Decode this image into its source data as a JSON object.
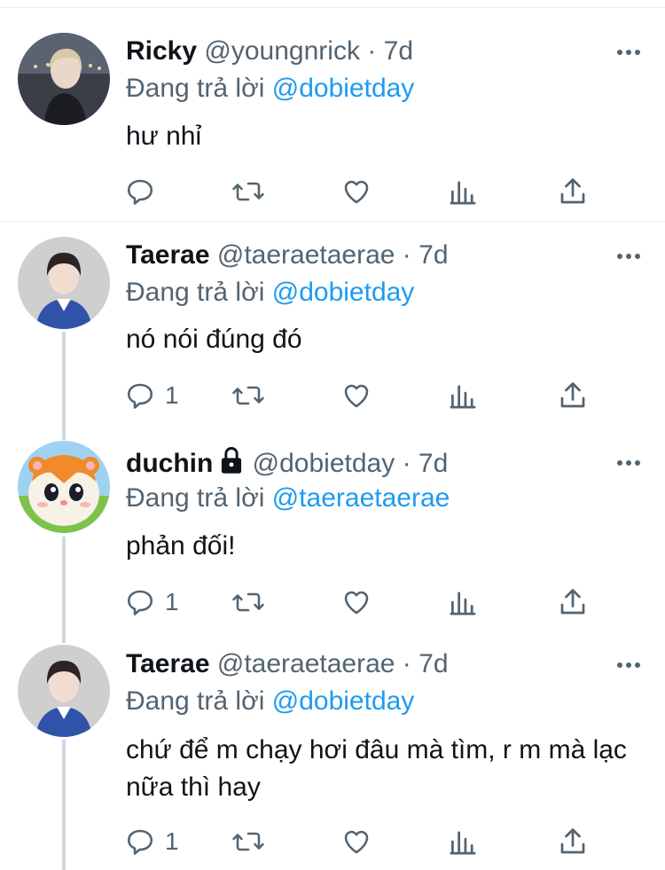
{
  "tweets": [
    {
      "name": "Ricky",
      "handle": "@youngnrick",
      "dot": "·",
      "time": "7d",
      "locked": false,
      "reply_prefix": "Đang trả lời",
      "reply_to": "@dobietday",
      "text": "hư nhỉ",
      "reply_count": "",
      "avatar": "person-dark-avatar"
    },
    {
      "name": "Taerae",
      "handle": "@taeraetaerae",
      "dot": "·",
      "time": "7d",
      "locked": false,
      "reply_prefix": "Đang trả lời",
      "reply_to": "@dobietday",
      "text": "nó nói đúng đó",
      "reply_count": "1",
      "avatar": "person-blue-sweater-avatar"
    },
    {
      "name": "duchin",
      "handle": "@dobietday",
      "dot": "·",
      "time": "7d",
      "locked": true,
      "reply_prefix": "Đang trả lời",
      "reply_to": "@taeraetaerae",
      "text": "phản đối!",
      "reply_count": "1",
      "avatar": "hamster-cartoon-avatar"
    },
    {
      "name": "Taerae",
      "handle": "@taeraetaerae",
      "dot": "·",
      "time": "7d",
      "locked": false,
      "reply_prefix": "Đang trả lời",
      "reply_to": "@dobietday",
      "text": "chứ để m chạy hơi đâu mà tìm, r m mà lạc nữa thì hay",
      "reply_count": "1",
      "avatar": "person-blue-sweater-avatar"
    }
  ],
  "colors": {
    "text_primary": "#0f1419",
    "text_secondary": "#536471",
    "link": "#1d9bf0",
    "divider": "#e6ecf0",
    "thread_line": "#cfd9de"
  },
  "icons": [
    "reply-icon",
    "retweet-icon",
    "like-icon",
    "analytics-icon",
    "share-icon",
    "more-icon",
    "lock-icon"
  ]
}
